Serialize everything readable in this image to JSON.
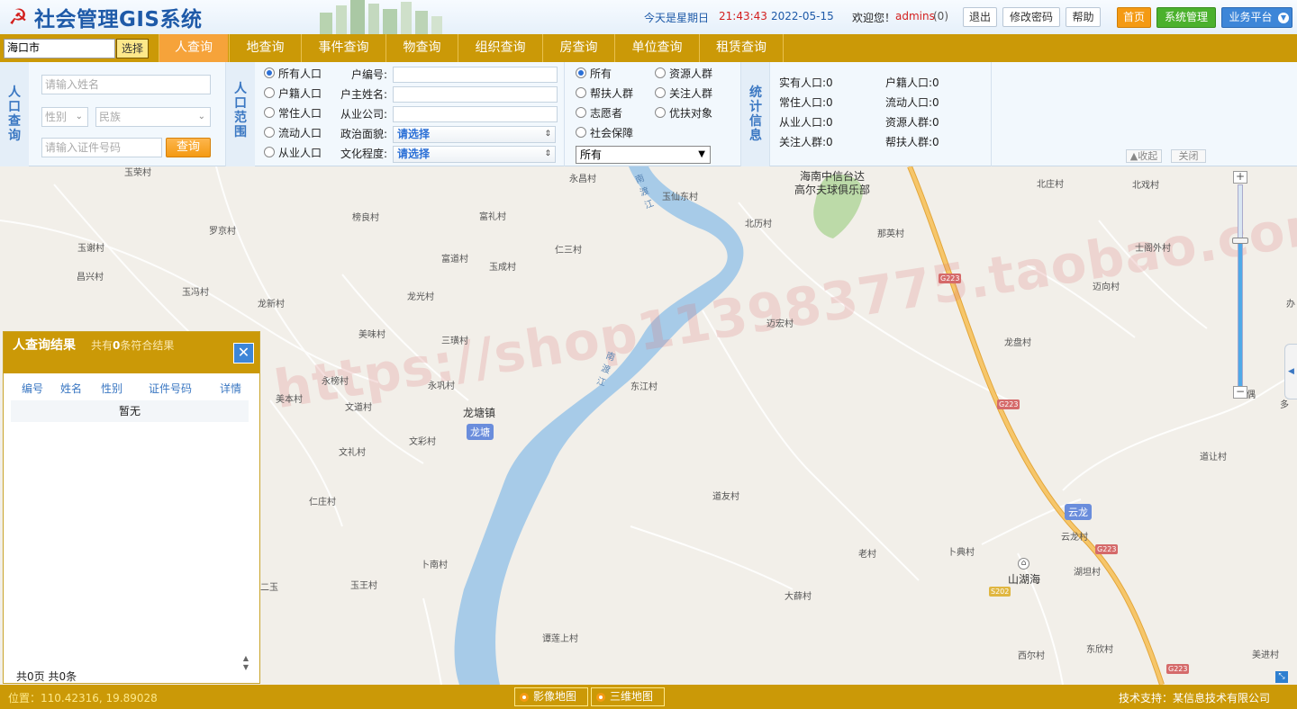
{
  "header": {
    "app_title": "社会管理GIS系统",
    "weekday": "今天是星期日",
    "time": "21:43:43",
    "date": "2022-05-15",
    "welcome": "欢迎您！",
    "username": "admins",
    "user_count": "(0)",
    "logout": "退出",
    "change_password": "修改密码",
    "help": "帮助",
    "home": "首页",
    "system_mgmt": "系统管理",
    "business_platform": "业务平台"
  },
  "nav": {
    "city_value": "海口市",
    "city_select": "选择",
    "tabs": [
      "人查询",
      "地查询",
      "事件查询",
      "物查询",
      "组织查询",
      "房查询",
      "单位查询",
      "租赁查询"
    ],
    "active_tab": 0
  },
  "person_query": {
    "label": "人口查询",
    "name_placeholder": "请输入姓名",
    "gender_placeholder": "性别",
    "ethnicity_placeholder": "民族",
    "id_placeholder": "请输入证件号码",
    "query_button": "查询"
  },
  "population_scope": {
    "label": "人口范围",
    "options": [
      "所有人口",
      "户籍人口",
      "常住人口",
      "流动人口",
      "从业人口"
    ],
    "selected": 0
  },
  "detail_fields": {
    "household_no": "户编号:",
    "householder_name": "户主姓名:",
    "employer": "从业公司:",
    "political_status": "政治面貌:",
    "education": "文化程度:",
    "select_default": "请选择"
  },
  "groups": {
    "options": [
      "所有",
      "资源人群",
      "帮扶人群",
      "关注人群",
      "志愿者",
      "优扶对象",
      "社会保障"
    ],
    "selected": 0,
    "dropdown_value": "所有"
  },
  "statistics": {
    "label": "统计信息",
    "items": [
      "实有人口:0",
      "户籍人口:0",
      "常住人口:0",
      "流动人口:0",
      "从业人口:0",
      "资源人群:0",
      "关注人群:0",
      "帮扶人群:0"
    ],
    "collapse": "收起",
    "close": "关闭"
  },
  "results": {
    "title": "人查询结果",
    "summary_prefix": "共有",
    "count": "0",
    "summary_suffix": "条符合结果",
    "columns": [
      "编号",
      "姓名",
      "性别",
      "证件号码",
      "详情"
    ],
    "empty": "暂无",
    "footer": "共0页  共0条"
  },
  "map": {
    "watermark": "https://shop113983775.taobao.com",
    "places": [
      "玉荣村",
      "永昌村",
      "玉仙东村",
      "北庄村",
      "北戏村",
      "榜良村",
      "富礼村",
      "北历村",
      "罗京村",
      "那英村",
      "玉谢村",
      "仁三村",
      "士阁外村",
      "昌兴村",
      "富道村",
      "玉成村",
      "迈向村",
      "玉冯村",
      "龙新村",
      "龙光村",
      "迈宏村",
      "美味村",
      "三璜村",
      "龙盘村",
      "永榜村",
      "永巩村",
      "东江村",
      "美本村",
      "文道村",
      "龙塘镇",
      "文礼村",
      "文彩村",
      "道让村",
      "道友村",
      "云龙村",
      "仁庄村",
      "老村",
      "卜典村",
      "山湖海",
      "卜南村",
      "湖坦村",
      "二玉",
      "玉王村",
      "大薛村",
      "谭莲上村",
      "西尔村",
      "东欣村",
      "美进村",
      "偶",
      "多",
      "办",
      "海南中信台达",
      "高尔夫球俱乐部"
    ],
    "river_labels": [
      "南渡江",
      "南渡江"
    ],
    "badges": [
      "龙塘",
      "云龙"
    ],
    "road_labels": [
      "G223",
      "G223",
      "G223",
      "G223",
      "S202"
    ]
  },
  "footer": {
    "position": "位置：110.42316, 19.89028",
    "map_tabs": [
      "影像地图",
      "三维地图"
    ],
    "tech_support": "技术支持：某信息技术有限公司"
  },
  "colors": {
    "nav_bg": "#cb9907",
    "active_tab": "#f6a33a",
    "accent_blue": "#3a77c2",
    "river": "#a7cbe8",
    "highway": "#f2b347"
  },
  "zoom_level_fraction": 0.73
}
